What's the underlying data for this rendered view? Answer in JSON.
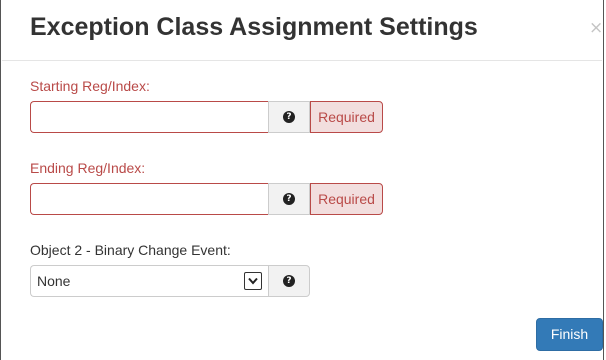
{
  "dialog": {
    "title": "Exception Class Assignment Settings",
    "close_glyph": "×"
  },
  "fields": {
    "starting": {
      "label": "Starting Reg/Index:",
      "value": "",
      "help_icon": "question-circle-icon",
      "required_label": "Required"
    },
    "ending": {
      "label": "Ending Reg/Index:",
      "value": "",
      "help_icon": "question-circle-icon",
      "required_label": "Required"
    },
    "object2": {
      "label": "Object 2 - Binary Change Event:",
      "selected": "None",
      "help_icon": "question-circle-icon"
    }
  },
  "actions": {
    "finish_label": "Finish"
  },
  "colors": {
    "error": "#b94a48",
    "error_bg": "#f2dede",
    "primary": "#337ab7"
  }
}
